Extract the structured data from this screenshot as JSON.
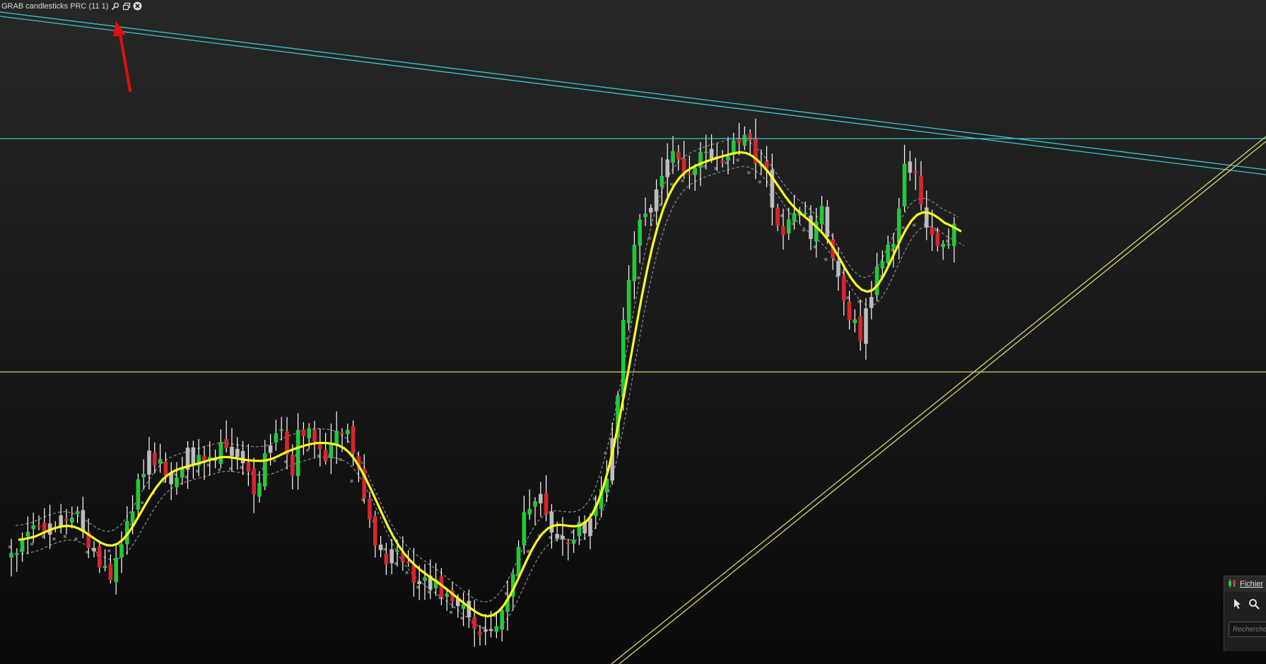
{
  "indicator_header": {
    "title": "GRAB candlesticks PRC (11 1)",
    "icons": [
      "wrench-icon",
      "window-restore-icon",
      "close-icon"
    ]
  },
  "side_panel": {
    "menu_label": "Fichier",
    "search_placeholder": "Recherche",
    "icons": [
      "candlestick-app-icon",
      "pointer-cursor-icon",
      "zoom-icon"
    ]
  },
  "colors": {
    "background_top": "#272727",
    "background_bottom": "#0a0a0a",
    "bullish_candle": "#22c93a",
    "bearish_candle": "#d9252f",
    "neutral_candle": "#bcbcbc",
    "wick": "#ffffff",
    "moving_average": "#ffff1a",
    "band_lines": "#8c8c8c",
    "trendline_cyan": "#3cc8d2",
    "trendline_yellow": "#d6d66a",
    "annotation_arrow": "#e01010"
  },
  "chart": {
    "series_shown": [
      "candlesticks",
      "smoothed moving average",
      "upper band",
      "lower band"
    ],
    "drawings": [
      "descending cyan double trendline",
      "horizontal cyan line",
      "horizontal yellow line",
      "ascending yellow double trendline",
      "red annotation arrow"
    ],
    "grid": false,
    "axes_labels_visible": false
  }
}
